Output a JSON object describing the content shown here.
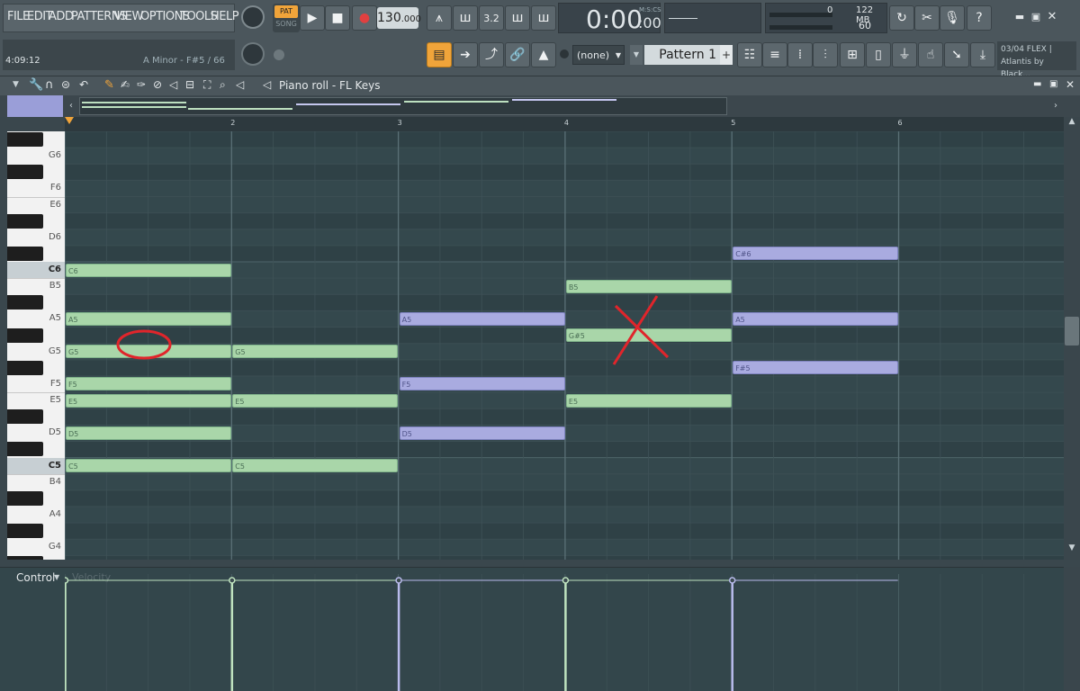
{
  "menu": [
    "FILE",
    "EDIT",
    "ADD",
    "PATTERNS",
    "VIEW",
    "OPTIONS",
    "TOOLS",
    "HELP"
  ],
  "transport": {
    "pat_label": "PAT",
    "song_label": "SONG",
    "tempo": "130",
    "tempo_decimals": ".000",
    "time_main": "0:00",
    "time_sub": ":00",
    "time_unit": "M:S:CS"
  },
  "status": {
    "time": "4:09:12",
    "hint": "A Minor - F#5 / 66"
  },
  "meters": {
    "cpu": "0",
    "memory": "122 MB",
    "polyphony": "60"
  },
  "pattern": {
    "channel": "(none)",
    "name": "Pattern 1"
  },
  "news": {
    "line1": "03/04  FLEX |",
    "line2": "Atlantis by Black..."
  },
  "piano_roll": {
    "title": "Piano roll - FL Keys",
    "control_label": "Control",
    "control_param": "Velocity"
  },
  "bars": [
    "2",
    "3",
    "4",
    "5",
    "6"
  ],
  "key_labels": [
    {
      "label": "G6",
      "c": false
    },
    {
      "label": "F6",
      "c": false
    },
    {
      "label": "E6",
      "c": false
    },
    {
      "label": "D6",
      "c": false
    },
    {
      "label": "C6",
      "c": true
    },
    {
      "label": "B5",
      "c": false
    },
    {
      "label": "A5",
      "c": false
    },
    {
      "label": "G5",
      "c": false
    },
    {
      "label": "F5",
      "c": false
    },
    {
      "label": "E5",
      "c": false
    },
    {
      "label": "D5",
      "c": false
    },
    {
      "label": "C5",
      "c": true
    },
    {
      "label": "B4",
      "c": false
    },
    {
      "label": "A4",
      "c": false
    },
    {
      "label": "G4",
      "c": false
    }
  ],
  "notes": [
    {
      "pitch": "C6",
      "bar": 0,
      "color": "green"
    },
    {
      "pitch": "A5",
      "bar": 0,
      "color": "green"
    },
    {
      "pitch": "G5",
      "bar": 0,
      "color": "green"
    },
    {
      "pitch": "F5",
      "bar": 0,
      "color": "green"
    },
    {
      "pitch": "E5",
      "bar": 0,
      "color": "green"
    },
    {
      "pitch": "D5",
      "bar": 0,
      "color": "green"
    },
    {
      "pitch": "C5",
      "bar": 0,
      "color": "green"
    },
    {
      "pitch": "G5",
      "bar": 1,
      "color": "green"
    },
    {
      "pitch": "E5",
      "bar": 1,
      "color": "green"
    },
    {
      "pitch": "C5",
      "bar": 1,
      "color": "green"
    },
    {
      "pitch": "A5",
      "bar": 2,
      "color": "purple"
    },
    {
      "pitch": "F5",
      "bar": 2,
      "color": "purple"
    },
    {
      "pitch": "D5",
      "bar": 2,
      "color": "purple"
    },
    {
      "pitch": "B5",
      "bar": 3,
      "color": "green"
    },
    {
      "pitch": "G#5",
      "bar": 3,
      "color": "green"
    },
    {
      "pitch": "E5",
      "bar": 3,
      "color": "green"
    },
    {
      "pitch": "C#6",
      "bar": 4,
      "color": "purple"
    },
    {
      "pitch": "A5",
      "bar": 4,
      "color": "purple"
    },
    {
      "pitch": "F#5",
      "bar": 4,
      "color": "purple"
    }
  ],
  "colors": {
    "note_green": "#a9d6a9",
    "note_purple": "#a9abe0",
    "accent_orange": "#f0a43a",
    "annotation_red": "#e0252b"
  }
}
